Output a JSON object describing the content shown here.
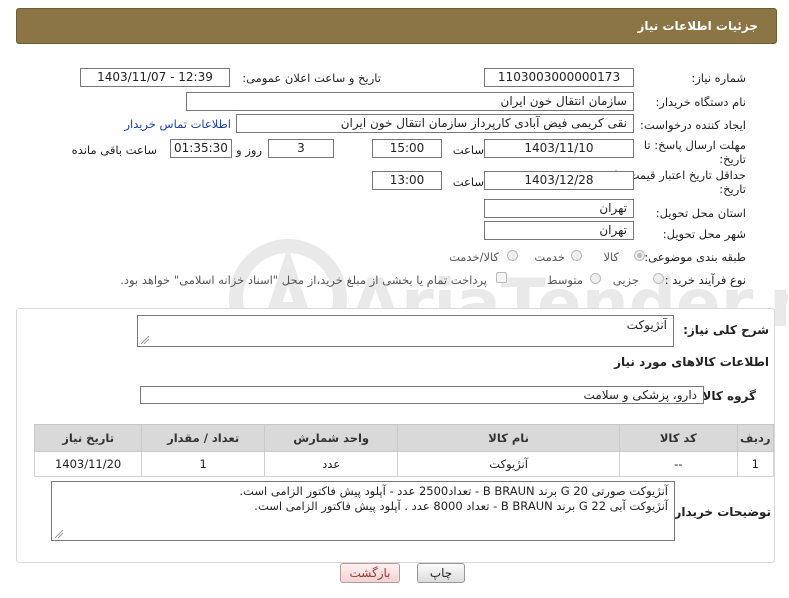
{
  "header": {
    "title": "جزئیات اطلاعات نیاز"
  },
  "fields": {
    "need_number_label": "شماره نیاز:",
    "need_number": "1103003000000173",
    "announce_label": "تاریخ و ساعت اعلان عمومی:",
    "announce_value": "1403/11/07 - 12:39",
    "buyer_org_label": "نام دستگاه خریدار:",
    "buyer_org": "سازمان انتقال خون ایران",
    "creator_label": "ایجاد کننده درخواست:",
    "creator": "نقی کریمی فیض آبادی کارپرداز سازمان انتقال خون ایران",
    "contact_link": "اطلاعات تماس خریدار",
    "deadline_label_1": "مهلت ارسال پاسخ: تا",
    "deadline_label_2": "تاریخ:",
    "deadline_date": "1403/11/10",
    "time_label": "ساعت",
    "deadline_time": "15:00",
    "days_count": "3",
    "days_label": "روز و",
    "remaining_time": "01:35:30",
    "remaining_label": "ساعت باقی مانده",
    "validity_label_1": "حداقل تاریخ اعتبار قیمت: تا",
    "validity_label_2": "تاریخ:",
    "validity_date": "1403/12/28",
    "validity_time_label": "ساعت",
    "validity_time": "13:00",
    "province_label": "استان محل تحویل:",
    "province": "تهران",
    "city_label": "شهر محل تحویل:",
    "city": "تهران",
    "category_label": "طبقه بندی موضوعی:",
    "category_options": [
      "کالا",
      "خدمت",
      "کالا/خدمت"
    ],
    "process_label": "نوع فرآیند خرید :",
    "process_options": [
      "جزیی",
      "متوسط"
    ],
    "payment_note": "پرداخت تمام یا بخشی از مبلغ خرید،از محل \"اسناد خزانه اسلامی\" خواهد بود."
  },
  "details": {
    "summary_label": "شرح کلی نیاز:",
    "summary": "آنژیوکت",
    "goods_info_title": "اطلاعات کالاهای مورد نیاز",
    "goods_group_label": "گروه کالا:",
    "goods_group": "دارو، پزشکی و سلامت",
    "table": {
      "headers": [
        "ردیف",
        "کد کالا",
        "نام کالا",
        "واحد شمارش",
        "تعداد / مقدار",
        "تاریخ نیاز"
      ],
      "rows": [
        [
          "1",
          "--",
          "آنژیوکت",
          "عدد",
          "1",
          "1403/11/20"
        ]
      ]
    },
    "buyer_notes_label": "توضیحات خریدار:",
    "buyer_notes_line1": "آنژیوکت صورتی G 20 برند B BRAUN  -  تعداد2500 عدد  - آپلود پیش فاکتور الزامی است.",
    "buyer_notes_line2": "آنژیوکت آبی   G 22  برند B BRAUN -   تعداد 8000 عدد   . آپلود پیش فاکتور الزامی است."
  },
  "buttons": {
    "print": "چاپ",
    "back": "بازگشت"
  },
  "watermark": {
    "text": "AriaTender.neT"
  },
  "colors": {
    "header_bg": "#8b7545",
    "link": "#1a3fb0",
    "back_button_text": "#aa3333"
  }
}
